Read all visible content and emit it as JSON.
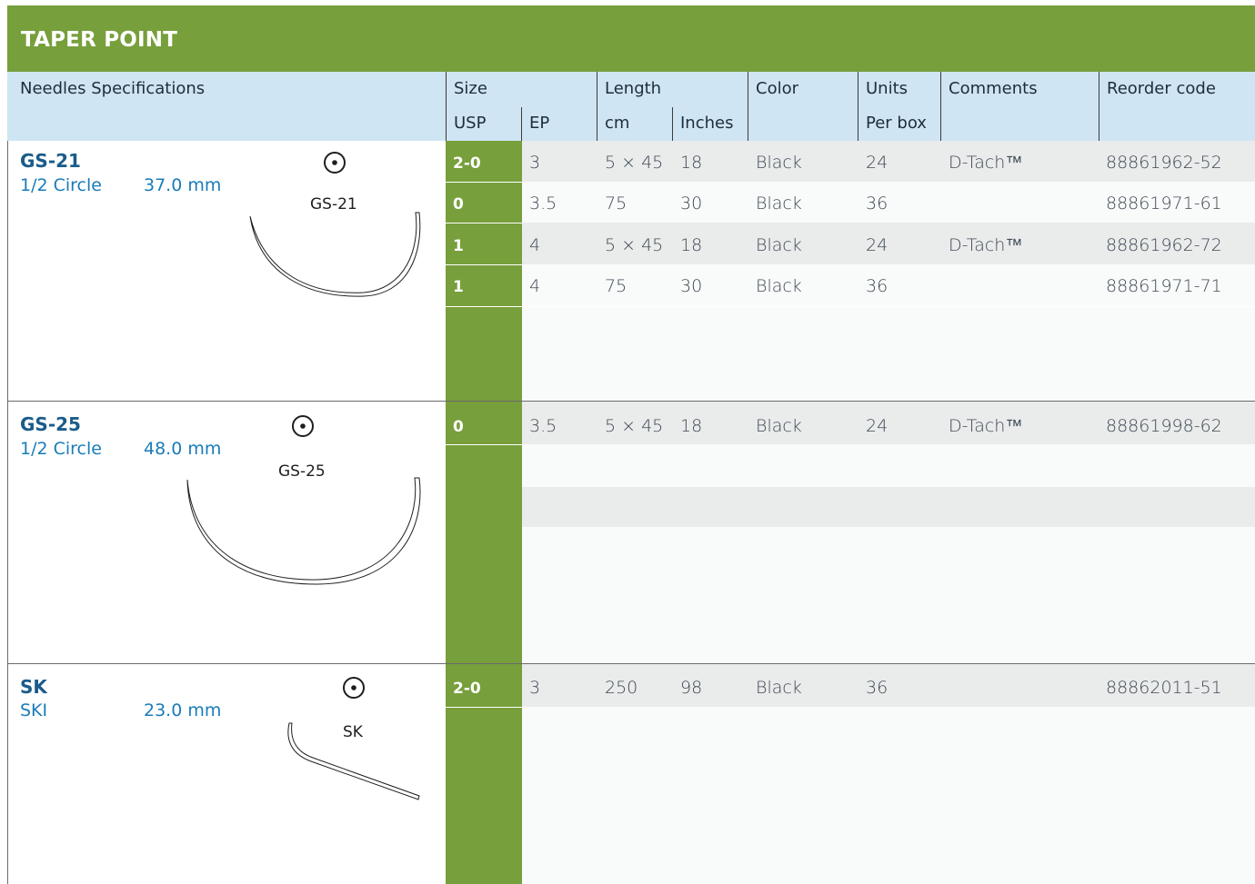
{
  "title": "TAPER POINT",
  "header": {
    "needles_spec": "Needles Specifications",
    "size": "Size",
    "usp": "USP",
    "ep": "EP",
    "length": "Length",
    "cm": "cm",
    "inches": "Inches",
    "color": "Color",
    "units": "Units",
    "per_box": "Per box",
    "comments": "Comments",
    "reorder_code": "Reorder code"
  },
  "sections": [
    {
      "name": "GS-21",
      "shape": "1/2 Circle",
      "size": "37.0 mm",
      "image_label": "GS-21",
      "icon": "dot-circle-icon",
      "rows": [
        {
          "usp": "2-0",
          "ep": "3",
          "cm": "5 × 45",
          "inches": "18",
          "color": "Black",
          "units": "24",
          "comments": "D-Tach™",
          "code": "88861962-52"
        },
        {
          "usp": "0",
          "ep": "3.5",
          "cm": "75",
          "inches": "30",
          "color": "Black",
          "units": "36",
          "comments": "",
          "code": "88861971-61"
        },
        {
          "usp": "1",
          "ep": "4",
          "cm": "5 × 45",
          "inches": "18",
          "color": "Black",
          "units": "24",
          "comments": "D-Tach™",
          "code": "88861962-72"
        },
        {
          "usp": "1",
          "ep": "4",
          "cm": "75",
          "inches": "30",
          "color": "Black",
          "units": "36",
          "comments": "",
          "code": "88861971-71"
        }
      ]
    },
    {
      "name": "GS-25",
      "shape": "1/2 Circle",
      "size": "48.0 mm",
      "image_label": "GS-25",
      "icon": "dot-circle-icon",
      "rows": [
        {
          "usp": "0",
          "ep": "3.5",
          "cm": "5 × 45",
          "inches": "18",
          "color": "Black",
          "units": "24",
          "comments": "D-Tach™",
          "code": "88861998-62"
        }
      ]
    },
    {
      "name": "SK",
      "shape": "SKI",
      "size": "23.0 mm",
      "image_label": "SK",
      "icon": "dot-circle-icon",
      "rows": [
        {
          "usp": "2-0",
          "ep": "3",
          "cm": "250",
          "inches": "98",
          "color": "Black",
          "units": "36",
          "comments": "",
          "code": "88862011-51"
        }
      ]
    }
  ],
  "colors": {
    "title_bar": "#779f3c",
    "header_bg": "#cfe5f3",
    "usp_column": "#779f3c",
    "row_gray": "#eaebeb",
    "needle_name": "#1a5c8a"
  }
}
